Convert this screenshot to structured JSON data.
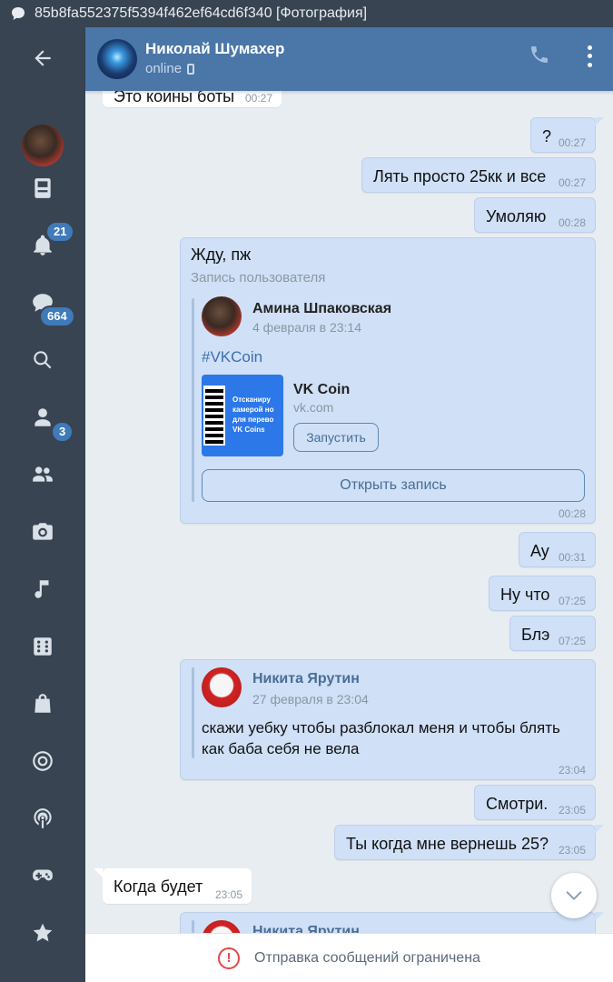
{
  "statusbar": {
    "title": "85b8fa552375f5394f462ef64cd6f340 [Фотография]"
  },
  "rail": {
    "badges": {
      "notifications": "21",
      "messages": "664",
      "friends": "3"
    }
  },
  "header": {
    "name": "Николай Шумахер",
    "status": "online"
  },
  "messages": [
    {
      "id": "m0",
      "dir": "in",
      "text": "Это коины боты",
      "time": "00:27"
    },
    {
      "id": "m1",
      "dir": "out",
      "text": "?",
      "time": "00:27"
    },
    {
      "id": "m2",
      "dir": "out",
      "text": "Лять просто 25кк и все",
      "time": "00:27"
    },
    {
      "id": "m3",
      "dir": "out",
      "text": "Умоляю",
      "time": "00:28"
    },
    {
      "id": "m5",
      "dir": "out",
      "text": "Ау",
      "time": "00:31"
    },
    {
      "id": "m6",
      "dir": "out",
      "text": "Ну что",
      "time": "07:25"
    },
    {
      "id": "m7",
      "dir": "out",
      "text": "Блэ",
      "time": "07:25"
    },
    {
      "id": "m9",
      "dir": "out",
      "text": "Смотри.",
      "time": "23:05"
    },
    {
      "id": "m10",
      "dir": "out",
      "text": "Ты когда мне вернешь 25?",
      "time": "23:05"
    },
    {
      "id": "m11",
      "dir": "in",
      "text": "Когда будет",
      "time": "23:05"
    }
  ],
  "post_message": {
    "text": "Жду,  пж",
    "subtitle": "Запись пользователя",
    "author": "Амина Шпаковская",
    "date": "4 февраля в 23:14",
    "hashtag": "#VKCoin",
    "link": {
      "image_lines": [
        "Отсканиру",
        "камерой но",
        "для перево",
        "VK Coins"
      ],
      "title": "VK Coin",
      "domain": "vk.com",
      "run_label": "Запустить"
    },
    "open_label": "Открыть запись",
    "time": "00:28"
  },
  "quote_message": {
    "author": "Никита Ярутин",
    "date": "27 февраля в 23:04",
    "text_lines": [
      "скажи уебку чтобы разблокал меня и чтобы блять",
      "как баба себя не вела"
    ],
    "time": "23:04"
  },
  "partial_message": {
    "author": "Никита Ярутин"
  },
  "bottom": {
    "text": "Отправка сообщений ограничена",
    "icon": "!"
  }
}
